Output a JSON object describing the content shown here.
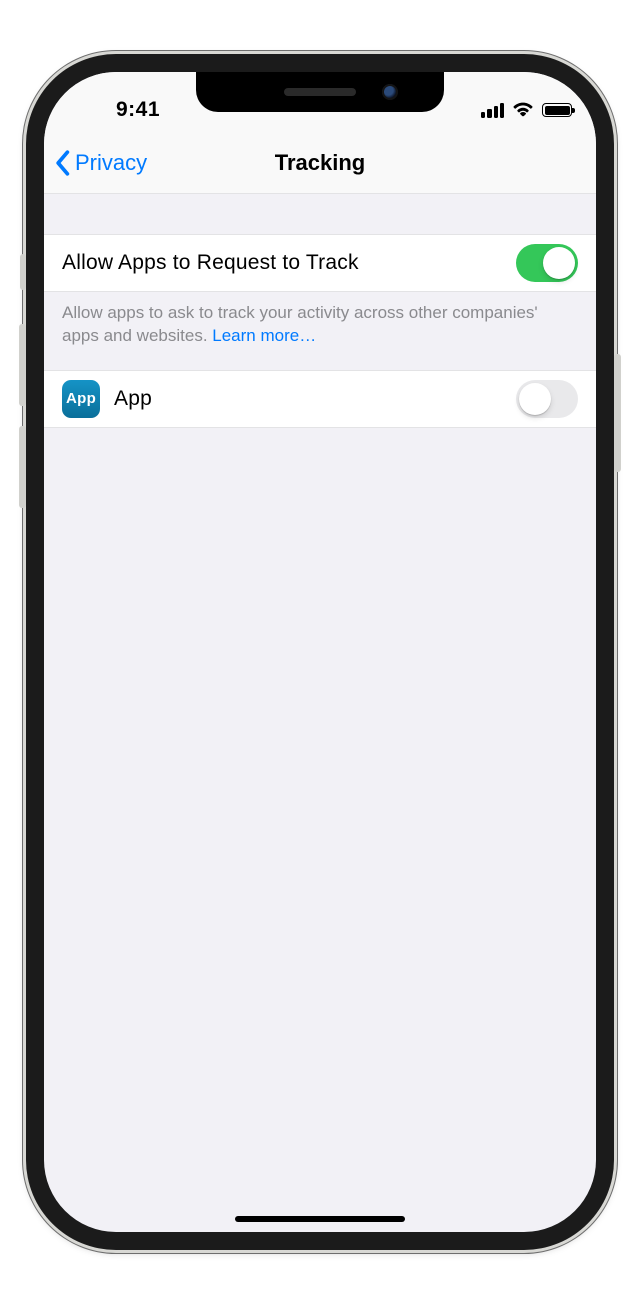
{
  "statusbar": {
    "time": "9:41"
  },
  "nav": {
    "back": "Privacy",
    "title": "Tracking"
  },
  "settings": {
    "allow_label": "Allow Apps to Request to Track",
    "allow_on": true,
    "footer_text": "Allow apps to ask to track your activity across other companies' apps and websites. ",
    "learn_more": "Learn more…"
  },
  "apps": [
    {
      "name": "App",
      "icon_text": "App",
      "on": false
    }
  ]
}
